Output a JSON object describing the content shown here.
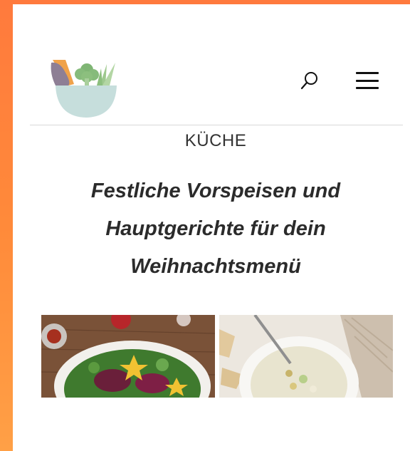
{
  "header": {
    "logo_icon": "vegetable-bowl-logo",
    "search_icon": "search-icon",
    "menu_icon": "hamburger-menu-icon"
  },
  "article": {
    "category": "KÜCHE",
    "title": "Festliche Vorspeisen und Hauptgerichte für dein Weihnachtsmenü"
  },
  "images": [
    {
      "name": "salad-image",
      "description_icon": "salad-photo"
    },
    {
      "name": "soup-image",
      "description_icon": "soup-photo"
    }
  ],
  "colors": {
    "frame_gradient_top": "#ff7a3d",
    "frame_gradient_bottom": "#ffa046",
    "logo_bowl": "#c6dedc",
    "logo_green": "#8cbf7e",
    "logo_purple": "#8e7f95",
    "logo_orange": "#f0a24a"
  }
}
